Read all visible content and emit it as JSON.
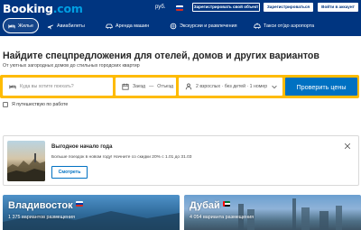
{
  "brand": {
    "name": "Booking",
    "suffix": ".com"
  },
  "header": {
    "currency": "руб.",
    "list_property": "Зарегистрировать свой объект",
    "register": "Зарегистрироваться",
    "sign_in": "Войти в аккаунт"
  },
  "nav": {
    "items": [
      {
        "label": "Жилье",
        "icon": "bed-icon"
      },
      {
        "label": "Авиабилеты",
        "icon": "plane-icon"
      },
      {
        "label": "Аренда машин",
        "icon": "car-icon"
      },
      {
        "label": "Экскурсии и развлечения",
        "icon": "attractions-icon"
      },
      {
        "label": "Такси от/до аэропорта",
        "icon": "taxi-icon"
      }
    ]
  },
  "hero": {
    "title": "Найдите спецпредложения для отелей, домов и других вариантов",
    "subtitle": "От уютных загородных домов до стильных городских квартир"
  },
  "search": {
    "destination_placeholder": "Куда вы хотите поехать?",
    "checkin": "Заезд",
    "separator": "—",
    "checkout": "Отъезд",
    "guests": "2 взрослых · без детей · 1 номер",
    "button": "Проверить цены",
    "work_travel": "Я путешествую по работе"
  },
  "promo": {
    "title": "Выгодное начало года",
    "text": "Больше поездок в новом году! Начните со скидки 20% с 1.01 до 31.03",
    "button": "Смотреть"
  },
  "cities": [
    {
      "name": "Владивосток",
      "count": "1 375 вариантов размещения"
    },
    {
      "name": "Дубай",
      "count": "4 054 варианта размещения"
    }
  ]
}
